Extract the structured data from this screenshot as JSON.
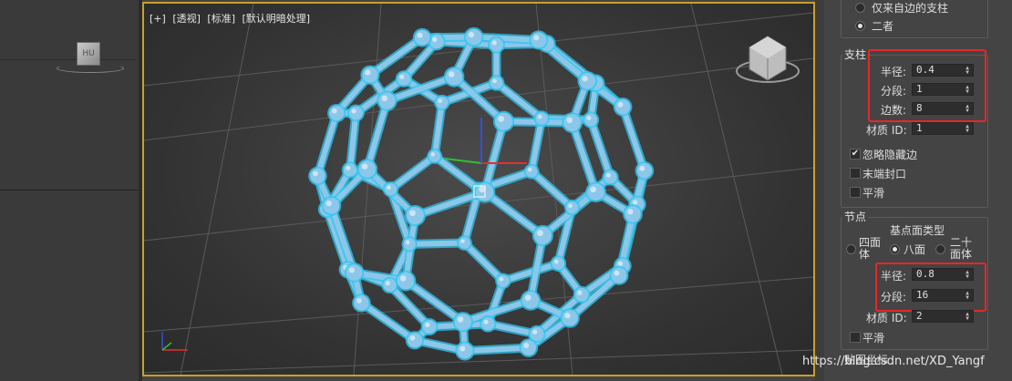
{
  "viewport": {
    "labels": [
      "[+]",
      "[透视]",
      "[标准]",
      "[默认明暗处理]"
    ]
  },
  "colors": {
    "selection_outline": "#c8a02a",
    "highlight_box": "#e8262a",
    "mesh_glow": "#2ec8f0",
    "mesh_body": "#8cc7ea",
    "axis_x": "#e03030",
    "axis_y": "#30c030",
    "axis_z": "#3050e0"
  },
  "panel": {
    "top_group": {
      "options": [
        {
          "label": "仅来自边的支柱",
          "selected": false
        },
        {
          "label": "二者",
          "selected": true
        }
      ]
    },
    "struts": {
      "title": "支柱",
      "radius_label": "半径:",
      "radius_value": "0.4",
      "segments_label": "分段:",
      "segments_value": "1",
      "sides_label": "边数:",
      "sides_value": "8",
      "material_label": "材质 ID:",
      "material_value": "1",
      "ignore_hidden_label": "忽略隐藏边",
      "ignore_hidden_checked": true,
      "end_caps_label": "末端封口",
      "end_caps_checked": false,
      "smooth_label": "平滑",
      "smooth_checked": false
    },
    "joints": {
      "title": "节点",
      "geodesic_title": "基点面类型",
      "type_options": [
        {
          "label_line1": "四面",
          "label_line2": "体",
          "selected": false
        },
        {
          "label_line1": "八面",
          "label_line2": "",
          "selected": true
        },
        {
          "label_line1": "二十",
          "label_line2": "面体",
          "selected": false
        }
      ],
      "radius_label": "半径:",
      "radius_value": "0.8",
      "segments_label": "分段:",
      "segments_value": "16",
      "material_label": "材质 ID:",
      "material_value": "2",
      "smooth_label": "平滑",
      "smooth_checked": false
    },
    "mapping_title": "贴图坐标"
  },
  "watermark": "https://blog.csdn.net/XD_Yangf"
}
